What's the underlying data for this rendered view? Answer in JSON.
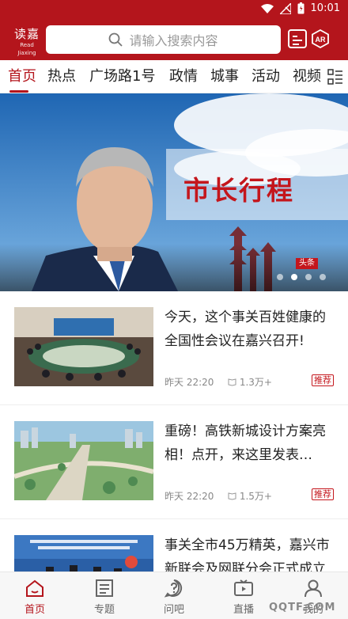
{
  "status_bar": {
    "time": "10:01"
  },
  "header": {
    "logo_cn": "读嘉",
    "logo_en": "Read Jiaxing",
    "search_placeholder": "请输入搜索内容",
    "ar_label": "AR"
  },
  "tabs": [
    "首页",
    "热点",
    "广场路1号",
    "政情",
    "城事",
    "活动",
    "视频"
  ],
  "banner": {
    "title": "市长行程",
    "badge": "头条",
    "dot_count": 4,
    "active_dot": 1
  },
  "news": [
    {
      "title": "今天，这个事关百姓健康的全国性会议在嘉兴召开!",
      "time": "昨天  22:20",
      "views": "1.3万+",
      "tag": "推荐"
    },
    {
      "title": "重磅！高铁新城设计方案亮相！点开，来这里发表…",
      "time": "昨天  22:20",
      "views": "1.5万+",
      "tag": "推荐"
    },
    {
      "title": "事关全市45万精英，嘉兴市新联会及网联分会正式成立",
      "time": "",
      "views": "",
      "tag": ""
    }
  ],
  "bottom_nav": [
    {
      "label": "首页",
      "icon": "home-icon",
      "active": true
    },
    {
      "label": "专题",
      "icon": "topic-icon",
      "active": false
    },
    {
      "label": "问吧",
      "icon": "question-icon",
      "active": false
    },
    {
      "label": "直播",
      "icon": "live-icon",
      "active": false
    },
    {
      "label": "我的",
      "icon": "user-icon",
      "active": false
    }
  ],
  "watermark": "QQTF.COM",
  "colors": {
    "brand_red": "#b4151c",
    "text_dark": "#222222",
    "text_gray": "#888888"
  }
}
